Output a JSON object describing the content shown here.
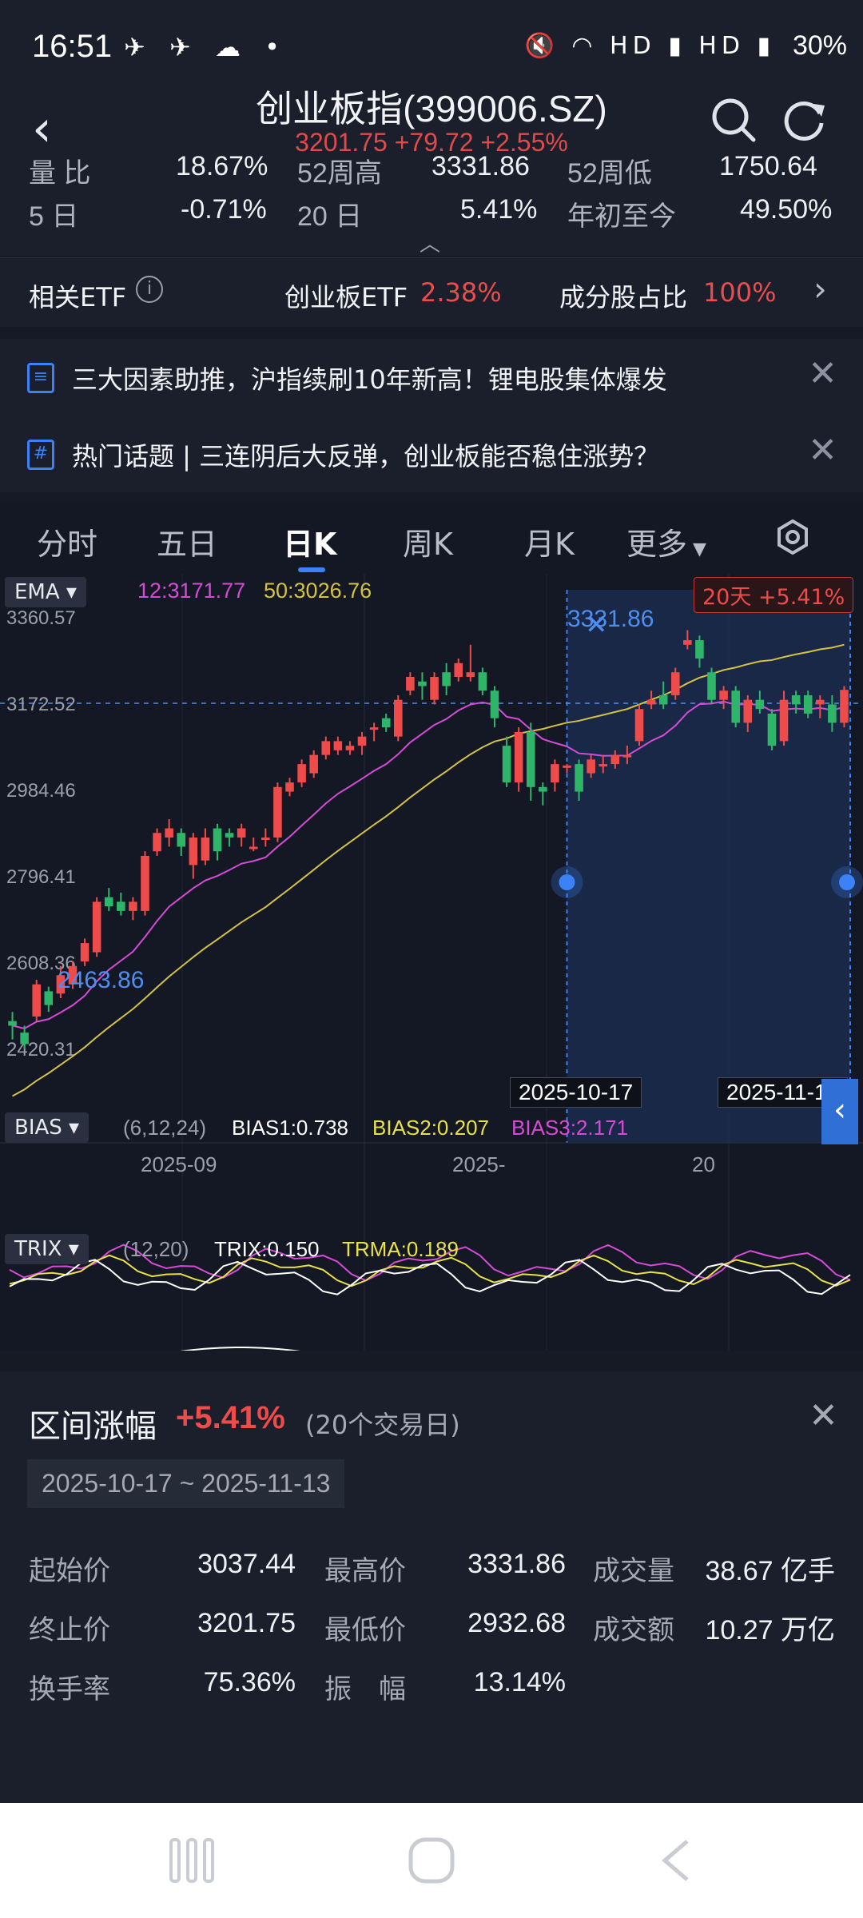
{
  "status_bar": {
    "time": "16:51",
    "right": "30%"
  },
  "header": {
    "title": "创业板指(399006.SZ)",
    "subtitle": "3201.75 +79.72 +2.55%"
  },
  "stats": {
    "row1": [
      {
        "label": "量 比",
        "value": "18.67%"
      },
      {
        "label": "52周高",
        "value": "3331.86"
      },
      {
        "label": "52周低",
        "value": "1750.64"
      }
    ],
    "row2": [
      {
        "label": "5 日",
        "value": "-0.71%"
      },
      {
        "label": "20 日",
        "value": "5.41%"
      },
      {
        "label": "年初至今",
        "value": "49.50%"
      }
    ]
  },
  "etf_row": {
    "label": "相关ETF",
    "info_icon": "info-icon",
    "etf_name": "创业板ETF",
    "etf_change": "2.38%",
    "ratio_label": "成分股占比",
    "ratio_value": "100%"
  },
  "news": [
    {
      "icon": "document-icon",
      "text": "三大因素助推，沪指续刷10年新高！锂电股集体爆发"
    },
    {
      "icon": "hashtag-icon",
      "text": "热门话题 | 三连阴后大反弹，创业板能否稳住涨势？"
    }
  ],
  "tabs": [
    {
      "label": "分时"
    },
    {
      "label": "五日"
    },
    {
      "label": "日K",
      "active": true
    },
    {
      "label": "周K"
    },
    {
      "label": "月K"
    },
    {
      "label": "更多"
    }
  ],
  "ema": {
    "label": "EMA",
    "ema12": "12:3171.77",
    "ema50": "50:3026.76",
    "range_badge": "20天 +5.41%",
    "high_mark": "3331.86",
    "low_mark": "2463.86"
  },
  "chart_data": {
    "type": "candlestick",
    "ylim": [
      2232.25,
      3360.57
    ],
    "yticks": [
      "3360.57",
      "3172.52",
      "2984.46",
      "2796.41",
      "2608.36",
      "2420.31",
      "2232.25"
    ],
    "xticks": [
      "2025-09",
      "2025-",
      "20"
    ],
    "selection_start": "2025-10-17",
    "selection_end": "2025-11-13",
    "colors": {
      "up": "#ee4b4b",
      "down": "#2fb56a",
      "ema12": "#d64bd6",
      "ema50": "#d4c341",
      "select": "#1a2c4d"
    },
    "candles": [
      [
        2480,
        2470,
        2500,
        2440
      ],
      [
        2455,
        2430,
        2470,
        2420
      ],
      [
        2490,
        2560,
        2570,
        2480
      ],
      [
        2545,
        2515,
        2555,
        2500
      ],
      [
        2540,
        2580,
        2600,
        2530
      ],
      [
        2560,
        2600,
        2610,
        2550
      ],
      [
        2610,
        2650,
        2660,
        2600
      ],
      [
        2630,
        2740,
        2750,
        2620
      ],
      [
        2750,
        2730,
        2770,
        2720
      ],
      [
        2740,
        2720,
        2760,
        2710
      ],
      [
        2720,
        2740,
        2750,
        2700
      ],
      [
        2720,
        2840,
        2850,
        2710
      ],
      [
        2850,
        2890,
        2900,
        2840
      ],
      [
        2880,
        2900,
        2920,
        2860
      ],
      [
        2890,
        2860,
        2900,
        2840
      ],
      [
        2820,
        2880,
        2890,
        2790
      ],
      [
        2830,
        2880,
        2900,
        2820
      ],
      [
        2900,
        2850,
        2910,
        2830
      ],
      [
        2890,
        2880,
        2900,
        2860
      ],
      [
        2880,
        2900,
        2910,
        2860
      ],
      [
        2860,
        2860,
        2880,
        2850
      ],
      [
        2880,
        2880,
        2900,
        2860
      ],
      [
        2880,
        2990,
        3000,
        2870
      ],
      [
        2980,
        3000,
        3010,
        2970
      ],
      [
        3000,
        3040,
        3050,
        2990
      ],
      [
        3020,
        3060,
        3070,
        3010
      ],
      [
        3060,
        3090,
        3100,
        3050
      ],
      [
        3070,
        3090,
        3100,
        3060
      ],
      [
        3070,
        3080,
        3090,
        3060
      ],
      [
        3080,
        3100,
        3110,
        3060
      ],
      [
        3120,
        3120,
        3130,
        3090
      ],
      [
        3140,
        3120,
        3150,
        3110
      ],
      [
        3100,
        3180,
        3190,
        3090
      ],
      [
        3200,
        3230,
        3240,
        3190
      ],
      [
        3220,
        3210,
        3240,
        3180
      ],
      [
        3180,
        3230,
        3240,
        3170
      ],
      [
        3240,
        3210,
        3260,
        3190
      ],
      [
        3230,
        3260,
        3270,
        3220
      ],
      [
        3230,
        3240,
        3300,
        3220
      ],
      [
        3240,
        3200,
        3250,
        3190
      ],
      [
        3200,
        3140,
        3210,
        3120
      ],
      [
        3080,
        3000,
        3100,
        2990
      ],
      [
        3000,
        3110,
        3120,
        2980
      ],
      [
        3110,
        2990,
        3130,
        2960
      ],
      [
        2990,
        2980,
        3000,
        2950
      ],
      [
        3000,
        3040,
        3050,
        2980
      ],
      [
        3037,
        3037,
        3040,
        3020
      ],
      [
        3040,
        2980,
        3050,
        2960
      ],
      [
        3020,
        3050,
        3060,
        3010
      ],
      [
        3040,
        3040,
        3060,
        3020
      ],
      [
        3040,
        3060,
        3070,
        3030
      ],
      [
        3060,
        3060,
        3080,
        3040
      ],
      [
        3090,
        3160,
        3170,
        3080
      ],
      [
        3170,
        3180,
        3200,
        3160
      ],
      [
        3190,
        3170,
        3220,
        3160
      ],
      [
        3190,
        3240,
        3250,
        3180
      ],
      [
        3300,
        3310,
        3331.86,
        3290
      ],
      [
        3310,
        3270,
        3320,
        3250
      ],
      [
        3240,
        3180,
        3250,
        3170
      ],
      [
        3180,
        3200,
        3210,
        3160
      ],
      [
        3200,
        3130,
        3210,
        3120
      ],
      [
        3130,
        3180,
        3190,
        3110
      ],
      [
        3180,
        3160,
        3200,
        3150
      ],
      [
        3150,
        3080,
        3160,
        3070
      ],
      [
        3090,
        3180,
        3200,
        3080
      ],
      [
        3190,
        3170,
        3200,
        3150
      ],
      [
        3190,
        3150,
        3200,
        3140
      ],
      [
        3170,
        3180,
        3190,
        3140
      ],
      [
        3170,
        3130,
        3190,
        3110
      ],
      [
        3130,
        3201.75,
        3210,
        3120
      ]
    ],
    "bias": {
      "label": "BIAS",
      "params": "(6,12,24)",
      "b1": "BIAS1:0.738",
      "b2": "BIAS2:0.207",
      "b3": "BIAS3:2.171"
    },
    "trix": {
      "label": "TRIX",
      "params": "(12,20)",
      "t1": "TRIX:0.150",
      "t2": "TRMA:0.189"
    }
  },
  "summary": {
    "title": "区间涨幅",
    "change": "+5.41%",
    "days": "(20个交易日)",
    "range": "2025-10-17 ~ 2025-11-13",
    "rows": [
      [
        {
          "l": "起始价",
          "v": "3037.44",
          "c": "white"
        },
        {
          "l": "最高价",
          "v": "3331.86",
          "c": "red"
        },
        {
          "l": "成交量",
          "v": "38.67 亿手",
          "c": "white"
        }
      ],
      [
        {
          "l": "终止价",
          "v": "3201.75",
          "c": "red"
        },
        {
          "l": "最低价",
          "v": "2932.68",
          "c": "green"
        },
        {
          "l": "成交额",
          "v": "10.27 万亿",
          "c": "white"
        }
      ],
      [
        {
          "l": "换手率",
          "v": "75.36%",
          "c": "white"
        },
        {
          "l": "振　幅",
          "v": "13.14%",
          "c": "white"
        }
      ]
    ]
  }
}
